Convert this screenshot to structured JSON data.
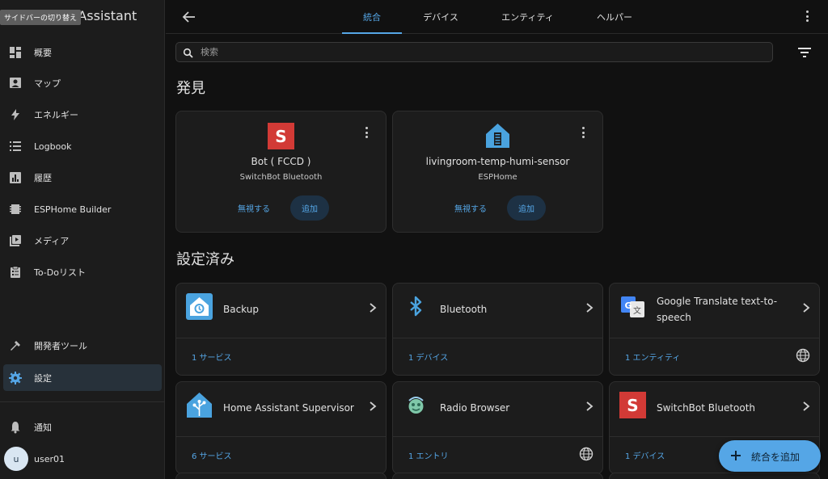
{
  "app": {
    "title": "Home Assistant",
    "sidebar_tooltip": "サイドバーの切り替え"
  },
  "sidebar": {
    "items": [
      {
        "label": "概要",
        "icon": "dashboard-icon"
      },
      {
        "label": "マップ",
        "icon": "map-icon"
      },
      {
        "label": "エネルギー",
        "icon": "lightning-icon"
      },
      {
        "label": "Logbook",
        "icon": "logbook-icon"
      },
      {
        "label": "履歴",
        "icon": "history-chart-icon"
      },
      {
        "label": "ESPHome Builder",
        "icon": "esphome-icon"
      },
      {
        "label": "メディア",
        "icon": "media-icon"
      },
      {
        "label": "To-Doリスト",
        "icon": "clipboard-list-icon"
      }
    ],
    "dev_tools": "開発者ツール",
    "settings": "設定",
    "notifications": "通知",
    "user": {
      "initial": "u",
      "name": "user01"
    }
  },
  "topbar": {
    "tabs": [
      "統合",
      "デバイス",
      "エンティティ",
      "ヘルパー"
    ],
    "active_tab": "統合"
  },
  "search": {
    "placeholder": "検索",
    "value": ""
  },
  "discovered": {
    "title": "発見",
    "cards": [
      {
        "name": "Bot ( FCCD )",
        "integration": "SwitchBot Bluetooth",
        "ignore": "無視する",
        "add": "追加",
        "icon": "switchbot-logo-icon"
      },
      {
        "name": "livingroom-temp-humi-sensor",
        "integration": "ESPHome",
        "ignore": "無視する",
        "add": "追加",
        "icon": "esphome-logo-icon"
      }
    ]
  },
  "configured": {
    "title": "設定済み",
    "cards": [
      {
        "name": "Backup",
        "link": "1 サービス",
        "icon": "backup-logo-icon",
        "cloud": false
      },
      {
        "name": "Bluetooth",
        "link": "1 デバイス",
        "icon": "bluetooth-logo-icon",
        "cloud": false
      },
      {
        "name": "Google Translate text-to-speech",
        "link": "1 エンティティ",
        "icon": "google-translate-logo-icon",
        "cloud": true
      },
      {
        "name": "Home Assistant Supervisor",
        "link": "6 サービス",
        "icon": "supervisor-logo-icon",
        "cloud": false
      },
      {
        "name": "Radio Browser",
        "link": "1 エントリ",
        "icon": "radio-browser-logo-icon",
        "cloud": true
      },
      {
        "name": "SwitchBot Bluetooth",
        "link": "1 デバイス",
        "icon": "switchbot-logo-icon",
        "cloud": false
      }
    ]
  },
  "fab": {
    "label": "統合を追加"
  },
  "colors": {
    "accent": "#55a6e6",
    "background": "#111111",
    "card": "#1c1c1c",
    "switchbot_red": "#d23a36",
    "esphome_blue": "#4aa3df"
  }
}
